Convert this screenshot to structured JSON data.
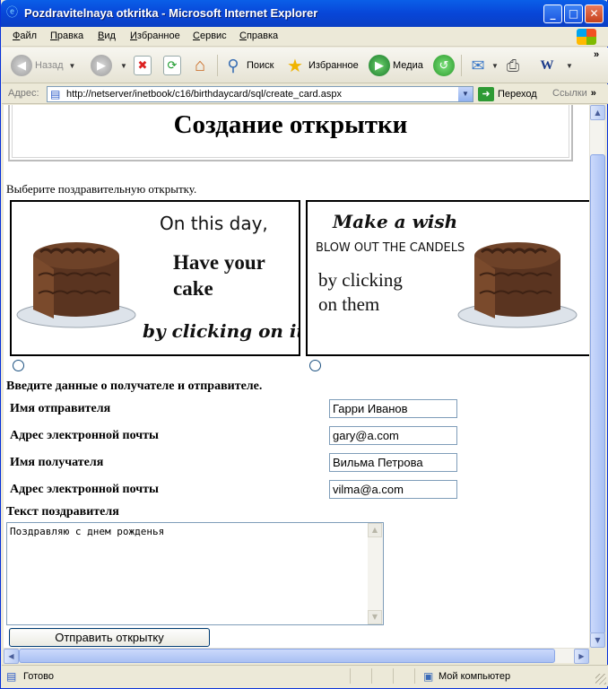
{
  "window": {
    "title": "Pozdravitelnaya otkritka - Microsoft Internet Explorer",
    "controls": {
      "minimize": "_",
      "maximize": "□",
      "close": "✕"
    }
  },
  "menu": [
    {
      "key": "Ф",
      "rest": "айл"
    },
    {
      "key": "П",
      "rest": "равка"
    },
    {
      "key": "В",
      "rest": "ид"
    },
    {
      "key": "И",
      "rest": "збранное"
    },
    {
      "key": "С",
      "rest": "ервис"
    },
    {
      "key": "С",
      "rest": "правка"
    }
  ],
  "toolbar": {
    "back": "Назад",
    "search": "Поиск",
    "favorites": "Избранное",
    "media": "Медиа",
    "chevron": "»"
  },
  "address": {
    "label": "Адрес:",
    "url": "http://netserver/inetbook/c16/birthdaycard/sql/create_card.aspx",
    "go": "Переход",
    "links": "Ссылки",
    "chevron": "»"
  },
  "page": {
    "title": "Создание открытки",
    "choose_prompt": "Выберите поздравительную открытку.",
    "cards": [
      {
        "lines": [
          "On this day,",
          "Have your",
          "cake",
          "by clicking on it"
        ]
      },
      {
        "lines": [
          "Make a wish",
          "BLOW OUT THE CANDELS",
          "by clicking",
          "on them"
        ]
      }
    ],
    "section_title": "Введите данные о получателе и отправителе.",
    "fields": [
      {
        "label": "Имя отправителя",
        "value": "Гарри Иванов"
      },
      {
        "label": "Адрес электронной почты",
        "value": "gary@a.com"
      },
      {
        "label": "Имя получателя",
        "value": "Вильма Петрова"
      },
      {
        "label": "Адрес электронной почты",
        "value": "vilma@a.com"
      }
    ],
    "message_label": "Текст поздравителя",
    "message_value": "Поздравляю с днем рожденья",
    "submit": "Отправить открытку"
  },
  "status": {
    "text": "Готово",
    "zone": "Мой компьютер"
  },
  "colors": {
    "titlebar": "#0a4fe0",
    "cake_brown": "#5a3420",
    "plate": "#dde3ea"
  }
}
